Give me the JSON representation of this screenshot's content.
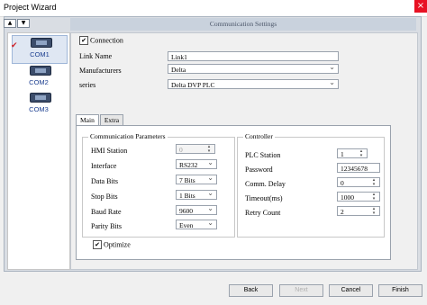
{
  "window": {
    "title": "Project Wizard",
    "close_glyph": "×"
  },
  "nav": {
    "up": "▲",
    "down": "▼"
  },
  "header": {
    "title": "Communication Settings"
  },
  "sidebar": {
    "items": [
      {
        "label": "COM1",
        "selected": true,
        "checked": true
      },
      {
        "label": "COM2",
        "selected": false,
        "checked": false
      },
      {
        "label": "COM3",
        "selected": false,
        "checked": false
      }
    ],
    "check_glyph": "✔"
  },
  "connection": {
    "label": "Connection",
    "checked": true,
    "link_name_label": "Link Name",
    "link_name_value": "Link1",
    "manufacturers_label": "Manufacturers",
    "manufacturers_value": "Delta",
    "series_label": "series",
    "series_value": "Delta DVP PLC"
  },
  "tabs": [
    {
      "label": "Main",
      "active": true
    },
    {
      "label": "Extra",
      "active": false
    }
  ],
  "comm_params": {
    "title": "Communication Parameters",
    "hmi_station_label": "HMI Station",
    "hmi_station_value": "0",
    "interface_label": "Interface",
    "interface_value": "RS232",
    "data_bits_label": "Data Bits",
    "data_bits_value": "7 Bits",
    "stop_bits_label": "Stop Bits",
    "stop_bits_value": "1 Bits",
    "baud_rate_label": "Baud Rate",
    "baud_rate_value": "9600",
    "parity_bits_label": "Parity Bits",
    "parity_bits_value": "Even"
  },
  "controller": {
    "title": "Controller",
    "plc_station_label": "PLC Station",
    "plc_station_value": "1",
    "password_label": "Password",
    "password_value": "12345678",
    "comm_delay_label": "Comm. Delay",
    "comm_delay_value": "0",
    "timeout_label": "Timeout(ms)",
    "timeout_value": "1000",
    "retry_count_label": "Retry Count",
    "retry_count_value": "2"
  },
  "optimize": {
    "label": "Optimize",
    "checked": true,
    "check_glyph": "✔"
  },
  "buttons": {
    "back": "Back",
    "next": "Next",
    "cancel": "Cancel",
    "finish": "Finish"
  },
  "colors": {
    "accent": "#1a3d8f",
    "close": "#e81123",
    "check": "#d0232a"
  }
}
